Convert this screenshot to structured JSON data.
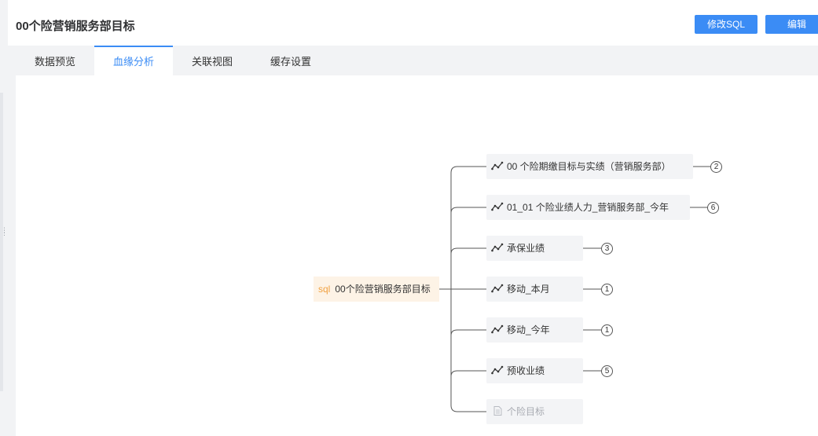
{
  "header": {
    "title": "00个险营销服务部目标",
    "modify_sql_label": "修改SQL",
    "edit_label": "编辑"
  },
  "tabs": [
    {
      "label": "数据预览",
      "active": false
    },
    {
      "label": "血缘分析",
      "active": true
    },
    {
      "label": "关联视图",
      "active": false
    },
    {
      "label": "缓存设置",
      "active": false
    }
  ],
  "lineage": {
    "root": {
      "tag": "sql",
      "label": "00个险营销服务部目标"
    },
    "children": [
      {
        "label": "00 个险期缴目标与实绩（营销服务部）",
        "icon": "line-chart-icon",
        "count": "2"
      },
      {
        "label": "01_01 个险业绩人力_营销服务部_今年",
        "icon": "line-chart-icon",
        "count": "6"
      },
      {
        "label": "承保业绩",
        "icon": "line-chart-icon",
        "count": "3"
      },
      {
        "label": "移动_本月",
        "icon": "line-chart-icon",
        "count": "1"
      },
      {
        "label": "移动_今年",
        "icon": "line-chart-icon",
        "count": "1"
      },
      {
        "label": "预收业绩",
        "icon": "line-chart-icon",
        "count": "5"
      },
      {
        "label": "个险目标",
        "icon": "document-icon",
        "count": null
      }
    ]
  },
  "colors": {
    "accent": "#3b8cf5",
    "root_bg": "#fdf3e6",
    "sql_tag": "#f0a040",
    "node_bg": "#f3f4f6"
  }
}
